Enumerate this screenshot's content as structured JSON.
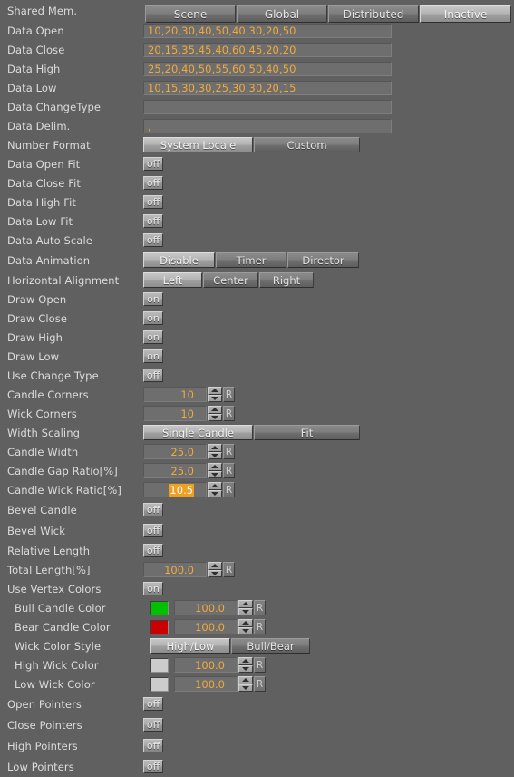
{
  "theme": {
    "bg": "#606060",
    "value_text": "#f0a93c",
    "label_text": "#dcdcdc",
    "selection_bg": "#f0a020"
  },
  "shared_mem": {
    "label": "Shared Mem.",
    "options": [
      "Scene",
      "Global",
      "Distributed",
      "Inactive"
    ],
    "selected": "Inactive"
  },
  "data_fields": [
    {
      "label": "Data Open",
      "value": "10,20,30,40,50,40,30,20,50"
    },
    {
      "label": "Data Close",
      "value": "20,15,35,45,40,60,45,20,20"
    },
    {
      "label": "Data High",
      "value": "25,20,40,50,55,60,50,40,50"
    },
    {
      "label": "Data Low",
      "value": "10,15,30,30,25,30,30,20,15"
    },
    {
      "label": "Data ChangeType",
      "value": ""
    },
    {
      "label": "Data Delim.",
      "value": ","
    }
  ],
  "number_format": {
    "label": "Number Format",
    "options": [
      "System Locale",
      "Custom"
    ],
    "selected": "System Locale"
  },
  "fit_toggles": [
    {
      "label": "Data Open Fit",
      "value": "off"
    },
    {
      "label": "Data Close Fit",
      "value": "off"
    },
    {
      "label": "Data High Fit",
      "value": "off"
    },
    {
      "label": "Data Low Fit",
      "value": "off"
    },
    {
      "label": "Data Auto Scale",
      "value": "off"
    }
  ],
  "data_animation": {
    "label": "Data Animation",
    "options": [
      "Disable",
      "Timer",
      "Director"
    ],
    "selected": "Disable"
  },
  "horizontal_alignment": {
    "label": "Horizontal Alignment",
    "options": [
      "Left",
      "Center",
      "Right"
    ],
    "selected": "Left"
  },
  "draw_toggles": [
    {
      "label": "Draw Open",
      "value": "on"
    },
    {
      "label": "Draw Close",
      "value": "on"
    },
    {
      "label": "Draw High",
      "value": "on"
    },
    {
      "label": "Draw Low",
      "value": "on"
    },
    {
      "label": "Use Change Type",
      "value": "off"
    }
  ],
  "corner_spinners": [
    {
      "label": "Candle Corners",
      "value": "10",
      "reset": "R"
    },
    {
      "label": "Wick Corners",
      "value": "10",
      "reset": "R"
    }
  ],
  "width_scaling": {
    "label": "Width Scaling",
    "options": [
      "Single Candle",
      "Fit"
    ],
    "selected": "Single Candle"
  },
  "candle_spinners": [
    {
      "label": "Candle Width",
      "value": "25.0",
      "reset": "R",
      "selected": false
    },
    {
      "label": "Candle Gap Ratio[%]",
      "value": "25.0",
      "reset": "R",
      "selected": false
    },
    {
      "label": "Candle Wick Ratio[%]",
      "value": "10.5",
      "reset": "R",
      "selected": true
    }
  ],
  "bevel_toggles": [
    {
      "label": "Bevel Candle",
      "value": "off"
    },
    {
      "label": "Bevel Wick",
      "value": "off"
    }
  ],
  "relative_length": {
    "label": "Relative Length",
    "value": "off"
  },
  "total_length": {
    "label": "Total Length[%]",
    "value": "100.0",
    "reset": "R"
  },
  "use_vertex_colors": {
    "label": "Use Vertex Colors",
    "value": "on"
  },
  "candle_colors": [
    {
      "label": "Bull Candle Color",
      "color": "#00c000",
      "value": "100.0",
      "reset": "R"
    },
    {
      "label": "Bear Candle Color",
      "color": "#cc0000",
      "value": "100.0",
      "reset": "R"
    }
  ],
  "wick_color_style": {
    "label": "Wick Color Style",
    "options": [
      "High/Low",
      "Bull/Bear"
    ],
    "selected": "High/Low"
  },
  "wick_colors": [
    {
      "label": "High Wick Color",
      "color": "#cccccc",
      "value": "100.0",
      "reset": "R"
    },
    {
      "label": "Low Wick Color",
      "color": "#cccccc",
      "value": "100.0",
      "reset": "R"
    }
  ],
  "pointer_toggles": [
    {
      "label": "Open Pointers",
      "value": "off"
    },
    {
      "label": "Close Pointers",
      "value": "off"
    },
    {
      "label": "High Pointers",
      "value": "off"
    },
    {
      "label": "Low Pointers",
      "value": "off"
    }
  ]
}
